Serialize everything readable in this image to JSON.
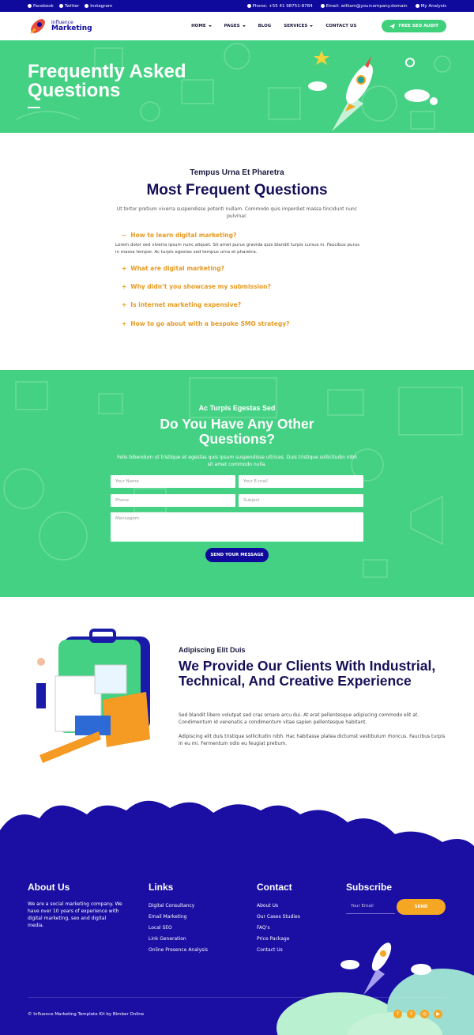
{
  "topbar": {
    "social": [
      {
        "icon": "facebook-icon",
        "label": "Facebook"
      },
      {
        "icon": "twitter-icon",
        "label": "Twitter"
      },
      {
        "icon": "instagram-icon",
        "label": "Instagram"
      }
    ],
    "phone": "Phone: +55 41 98751-8784",
    "email": "Email: william@yourcompany.domain",
    "account": "My Analysis"
  },
  "nav": {
    "logo_small": "Influence",
    "logo_big": "Marketing",
    "items": [
      {
        "label": "HOME",
        "dropdown": true
      },
      {
        "label": "PAGES",
        "dropdown": true
      },
      {
        "label": "BLOG",
        "dropdown": false
      },
      {
        "label": "SERVICES",
        "dropdown": true
      },
      {
        "label": "CONTACT US",
        "dropdown": false
      }
    ],
    "cta": "FREE SEO AUDIT"
  },
  "hero": {
    "title": "Frequently Asked Questions"
  },
  "faq": {
    "kicker": "Tempus Urna Et Pharetra",
    "title": "Most Frequent Questions",
    "intro": "Ut tortor pretium viverra suspendisse potenti nullam. Commodo quis imperdiet massa tincidunt nunc pulvinar.",
    "items": [
      {
        "q": "How to learn digital marketing?",
        "open": true,
        "a": "Lorem dolor sed viverra ipsum nunc aliquet. Sit amet purus gravida quis blandit turpis cursus in. Faucibus purus in massa tempor. Ac turpis egestas sed tempus urna et pharetra."
      },
      {
        "q": "What are digital marketing?",
        "open": false
      },
      {
        "q": "Why didn’t you showcase my submission?",
        "open": false
      },
      {
        "q": "Is internet marketing expensive?",
        "open": false
      },
      {
        "q": "How to go about with a bespoke SMO strategy?",
        "open": false
      }
    ]
  },
  "contact": {
    "kicker": "Ac Turpis Egestas Sed",
    "title": "Do You Have Any Other Questions?",
    "intro": "Felis bibendum ut tristique et egestas quis ipsum suspendisse ultrices. Duis tristique sollicitudin nibh sit amet commodo nulla.",
    "name_ph": "Your Name",
    "email_ph": "Your E-mail",
    "phone_ph": "Phone",
    "subject_ph": "Subject",
    "message_ph": "Mensagem",
    "button": "SEND YOUR MESSAGE"
  },
  "about": {
    "kicker": "Adipiscing Elit Duis",
    "title": "We Provide Our Clients With Industrial, Technical, And Creative Experience",
    "p1": "Sed blandit libero volutpat sed cras ornare arcu dui. At erat pellentesque adipiscing commodo elit at. Condimentum id venenatis a condimentum vitae sapien pellentesque habitant.",
    "p2": "Adipiscing elit duis tristique sollicitudin nibh. Hac habitasse platea dictumst vestibulum rhoncus. Faucibus turpis in eu mi. Fermentum odio eu feugiat pretium."
  },
  "footer": {
    "about_title": "About Us",
    "about_text": "We are a social marketing company. We have over 10 years of experience with digital marketing, seo and digital media.",
    "links_title": "Links",
    "links": [
      "Digital Consultancy",
      "Email Marketing",
      "Local SEO",
      "Link Generation",
      "Online Presence Analysis"
    ],
    "contact_title": "Contact",
    "contact_links": [
      "About Us",
      "Our Cases Studies",
      "FAQ’s",
      "Price Package",
      "Contact Us"
    ],
    "subscribe_title": "Subscribe",
    "email_ph": "Your Email",
    "send": "SEND",
    "copyright": "© Influence Marketing Template Kit by Bimber Online",
    "social_icons": [
      "facebook-icon",
      "twitter-icon",
      "instagram-icon",
      "youtube-icon"
    ]
  },
  "colors": {
    "primary": "#0f0a9c",
    "green": "#45d183",
    "accent": "#e59a23",
    "orange": "#f5a623"
  }
}
